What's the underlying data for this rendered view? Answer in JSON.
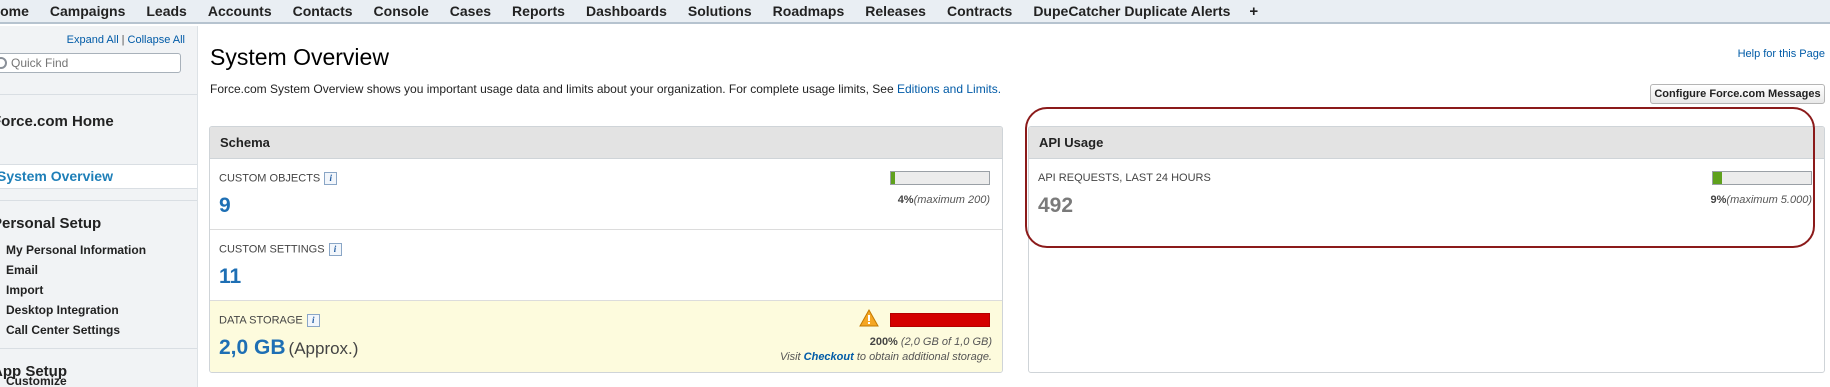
{
  "nav": {
    "tabs": [
      "Home",
      "Campaigns",
      "Leads",
      "Accounts",
      "Contacts",
      "Console",
      "Cases",
      "Reports",
      "Dashboards",
      "Solutions",
      "Roadmaps",
      "Releases",
      "Contracts",
      "DupeCatcher Duplicate Alerts"
    ],
    "plus": "+"
  },
  "sidebar": {
    "expand_all": "Expand All",
    "separator": "|",
    "collapse_all": "Collapse All",
    "quick_find_placeholder": "Quick Find",
    "forcecom_home": "Force.com Home",
    "system_overview": "System Overview",
    "personal_setup": "Personal Setup",
    "personal_items": [
      "My Personal Information",
      "Email",
      "Import",
      "Desktop Integration",
      "Call Center Settings"
    ],
    "app_setup": "App Setup",
    "app_items": [
      "Customize"
    ]
  },
  "main": {
    "title": "System Overview",
    "help_link": "Help for this Page",
    "intro_text": "Force.com System Overview shows you important usage data and limits about your organization. For complete usage limits, See ",
    "intro_link": "Editions and Limits.",
    "configure_button": "Configure Force.com Messages"
  },
  "schema": {
    "title": "Schema",
    "custom_objects": {
      "label": "CUSTOM OBJECTS",
      "value": "9",
      "percent": "4%",
      "max": "(maximum 200)",
      "fill_fraction": 0.045
    },
    "custom_settings": {
      "label": "CUSTOM SETTINGS",
      "value": "11"
    },
    "data_storage": {
      "label": "DATA STORAGE",
      "value": "2,0 GB",
      "approx": "(Approx.)",
      "percent": "200%",
      "detail": "(2,0 GB of 1,0 GB)",
      "note_prefix": "Visit ",
      "note_link": "Checkout",
      "note_suffix": " to obtain additional storage.",
      "fill_fraction": 1.0
    }
  },
  "api": {
    "title": "API Usage",
    "requests": {
      "label": "API REQUESTS, LAST 24 HOURS",
      "value": "492",
      "percent": "9%",
      "max": "(maximum 5.000)",
      "fill_fraction": 0.09
    }
  },
  "info_glyph": "i",
  "colors": {
    "accent_link": "#015ba7",
    "value_blue": "#1e6fb4",
    "bar_green": "#5fa11d",
    "bar_red": "#d40000",
    "warning_bg": "#fdfbdd",
    "highlight": "#8b1a1a"
  }
}
